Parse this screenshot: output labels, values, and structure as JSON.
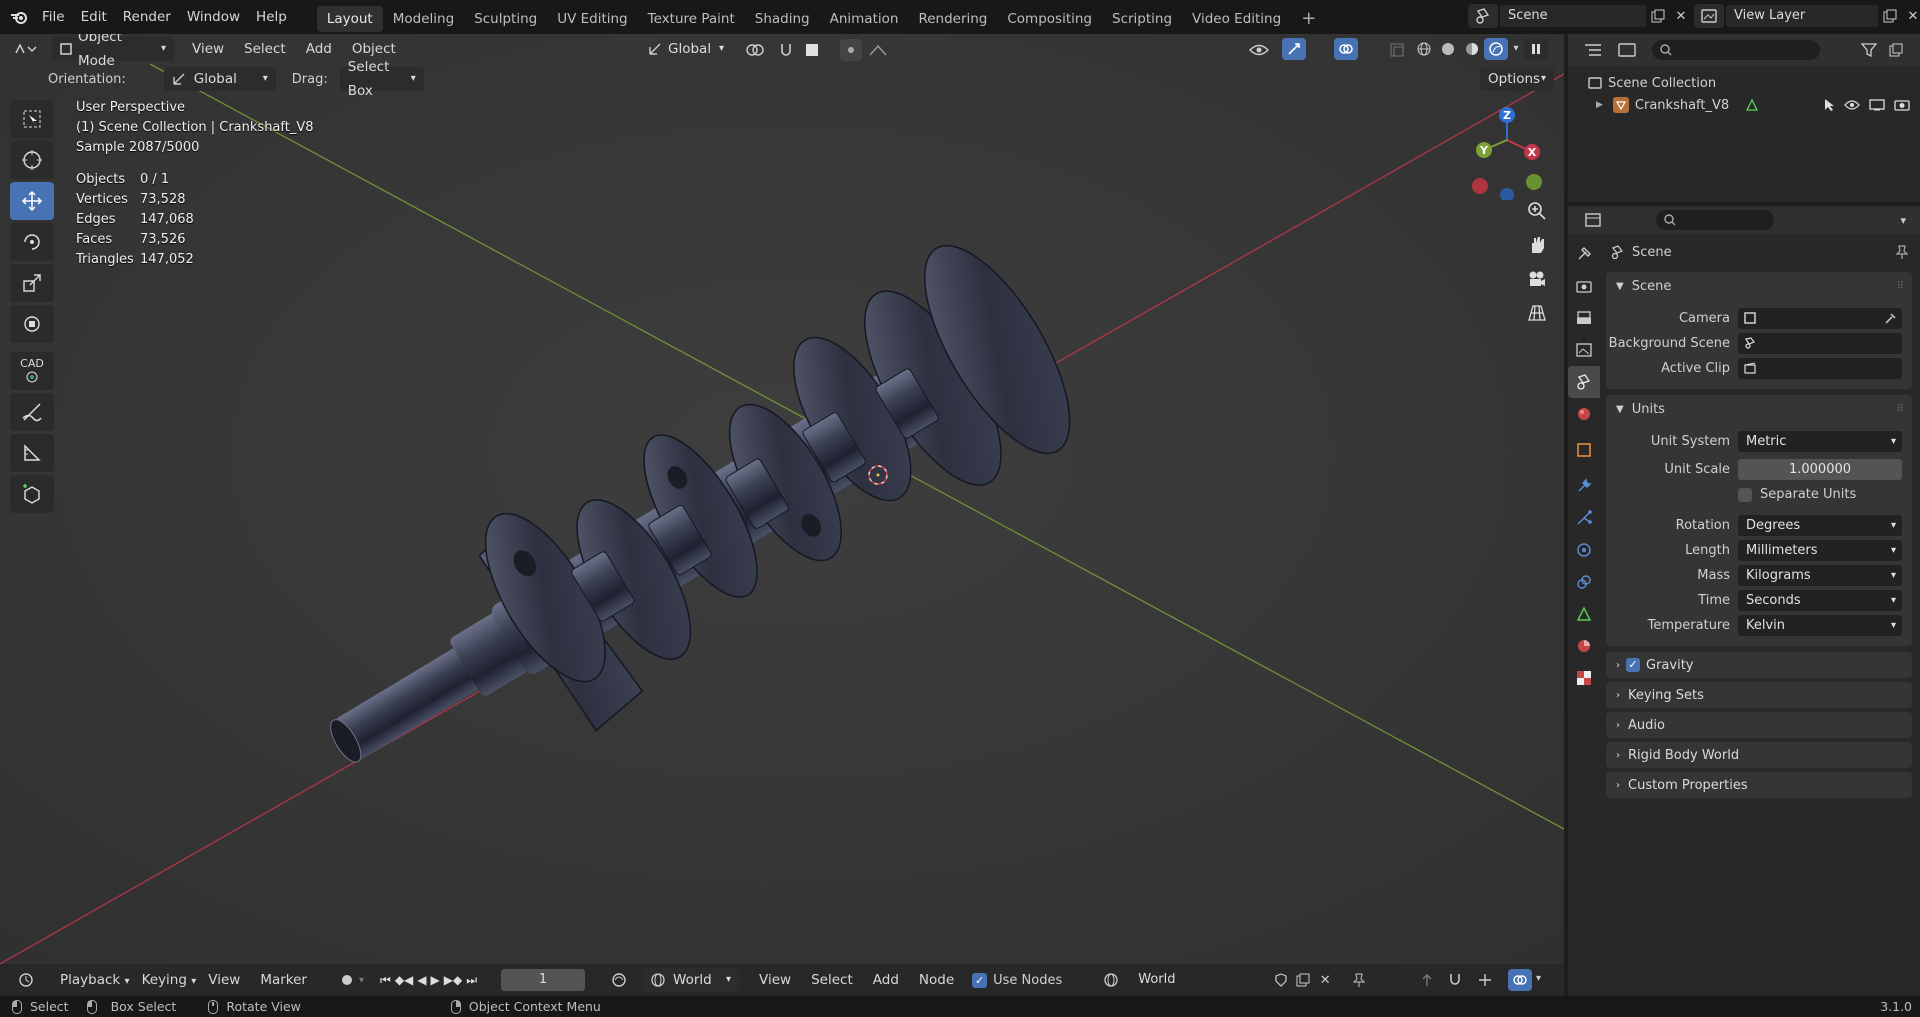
{
  "topbar": {
    "menus": [
      "File",
      "Edit",
      "Render",
      "Window",
      "Help"
    ],
    "workspaces": [
      "Layout",
      "Modeling",
      "Sculpting",
      "UV Editing",
      "Texture Paint",
      "Shading",
      "Animation",
      "Rendering",
      "Compositing",
      "Scripting",
      "Video Editing"
    ],
    "active_workspace": "Layout",
    "scene": "Scene",
    "view_layer": "View Layer"
  },
  "viewport": {
    "mode": "Object Mode",
    "menus": [
      "View",
      "Select",
      "Add",
      "Object"
    ],
    "transform_orientation": "Global",
    "orientation_label": "Orientation:",
    "orientation_value": "Global",
    "drag_label": "Drag:",
    "drag_value": "Select Box",
    "options_label": "Options",
    "overlay": {
      "perspective": "User Perspective",
      "collection": "(1) Scene Collection | Crankshaft_V8",
      "sample": "Sample 2087/5000",
      "stats": [
        {
          "label": "Objects",
          "value": "0 / 1"
        },
        {
          "label": "Vertices",
          "value": "73,528"
        },
        {
          "label": "Edges",
          "value": "147,068"
        },
        {
          "label": "Faces",
          "value": "73,526"
        },
        {
          "label": "Triangles",
          "value": "147,052"
        }
      ]
    },
    "gizmo": {
      "x": "X",
      "y": "Y",
      "z": "Z"
    },
    "tool_cad_label": "CAD"
  },
  "outliner": {
    "root": "Scene Collection",
    "item": "Crankshaft_V8"
  },
  "properties": {
    "context": "Scene",
    "scene_panel": {
      "title": "Scene",
      "rows": [
        {
          "label": "Camera",
          "value": ""
        },
        {
          "label": "Background Scene",
          "value": ""
        },
        {
          "label": "Active Clip",
          "value": ""
        }
      ]
    },
    "units_panel": {
      "title": "Units",
      "unit_system_label": "Unit System",
      "unit_system": "Metric",
      "unit_scale_label": "Unit Scale",
      "unit_scale": "1.000000",
      "separate_units": "Separate Units",
      "rows": [
        {
          "label": "Rotation",
          "value": "Degrees"
        },
        {
          "label": "Length",
          "value": "Millimeters"
        },
        {
          "label": "Mass",
          "value": "Kilograms"
        },
        {
          "label": "Time",
          "value": "Seconds"
        },
        {
          "label": "Temperature",
          "value": "Kelvin"
        }
      ]
    },
    "collapsed_panels": [
      "Gravity",
      "Keying Sets",
      "Audio",
      "Rigid Body World",
      "Custom Properties"
    ]
  },
  "timeline": {
    "playback": "Playback",
    "keying": "Keying",
    "view": "View",
    "marker": "Marker",
    "frame": "1",
    "world_type": "World",
    "menus": [
      "View",
      "Select",
      "Add",
      "Node"
    ],
    "use_nodes": "Use Nodes",
    "world_name": "World"
  },
  "statusbar": {
    "select": "Select",
    "box_select": "Box Select",
    "rotate_view": "Rotate View",
    "context_menu": "Object Context Menu",
    "version": "3.1.0"
  },
  "colors": {
    "accent": "#4772b3",
    "x_axis": "#c4384a",
    "y_axis": "#7aa236",
    "z_axis": "#2f6fd1"
  }
}
